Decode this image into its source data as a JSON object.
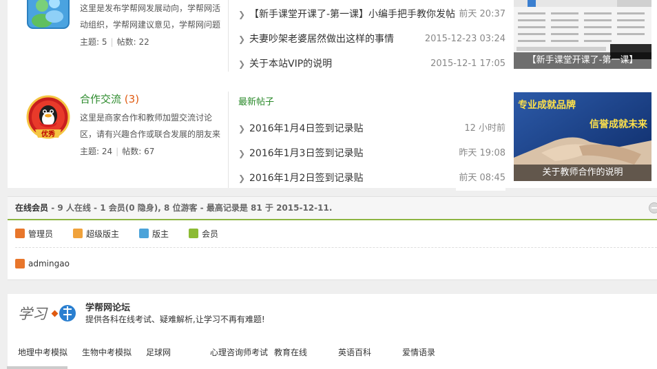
{
  "forums": [
    {
      "title": "",
      "count": "",
      "description": "这里是发布学帮网发展动向，学帮网活动组织，学帮网建议意见，学帮网问题",
      "stats_topics_label": "主题:",
      "stats_topics": "5",
      "stats_posts_label": "帖数:",
      "stats_posts": "22",
      "threads_header": "",
      "threads": [
        {
          "title": "【新手课堂开课了-第一课】小编手把手教你发帖",
          "date": "前天 20:37"
        },
        {
          "title": "夫妻吵架老婆居然做出这样的事情",
          "date": "2015-12-23 03:24"
        },
        {
          "title": "关于本站VIP的说明",
          "date": "2015-12-1 17:05"
        }
      ],
      "thumb_caption": "【新手课堂开课了-第一课】"
    },
    {
      "title": "合作交流",
      "count": "(3)",
      "description": "这里是商家合作和教师加盟交流讨论区，请有兴趣合作或联合发展的朋友来",
      "stats_topics_label": "主题:",
      "stats_topics": "24",
      "stats_posts_label": "帖数:",
      "stats_posts": "67",
      "threads_header": "最新帖子",
      "threads": [
        {
          "title": "2016年1月4日签到记录贴",
          "date": "12 小时前"
        },
        {
          "title": "2016年1月3日签到记录贴",
          "date": "昨天 19:08"
        },
        {
          "title": "2016年1月2日签到记录贴",
          "date": "前天 08:45"
        }
      ],
      "thumb_caption": "关于教师合作的说明",
      "thumb_banner_line1": "专业成就品牌",
      "thumb_banner_line2": "信誉成就未来",
      "badge_text": "优秀"
    }
  ],
  "online": {
    "label": "在线会员",
    "summary": " - 9 人在线 - 1 会员(0 隐身), 8 位游客 - 最高记录是 81 于 2015-12-11.",
    "legend": [
      {
        "label": "管理员",
        "color": "#e8762b"
      },
      {
        "label": "超级版主",
        "color": "#f0a23b"
      },
      {
        "label": "版主",
        "color": "#4ba3d9"
      },
      {
        "label": "会员",
        "color": "#8cbb33"
      }
    ],
    "members": [
      {
        "name": "admingao",
        "color": "#e8762b"
      }
    ]
  },
  "footer": {
    "logo_text": "学习",
    "site_name": "学帮网论坛",
    "slogan": "提供各科在线考试、疑难解析,让学习不再有难题!",
    "links": [
      "地理中考模拟",
      "生物中考模拟",
      "足球网",
      "心理咨询师考试",
      "教育在线",
      "英语百科",
      "爱情语录"
    ]
  },
  "colors": {
    "accent_green": "#2b8a2b",
    "count_orange": "#e05a10",
    "divider_green": "#8db441"
  }
}
